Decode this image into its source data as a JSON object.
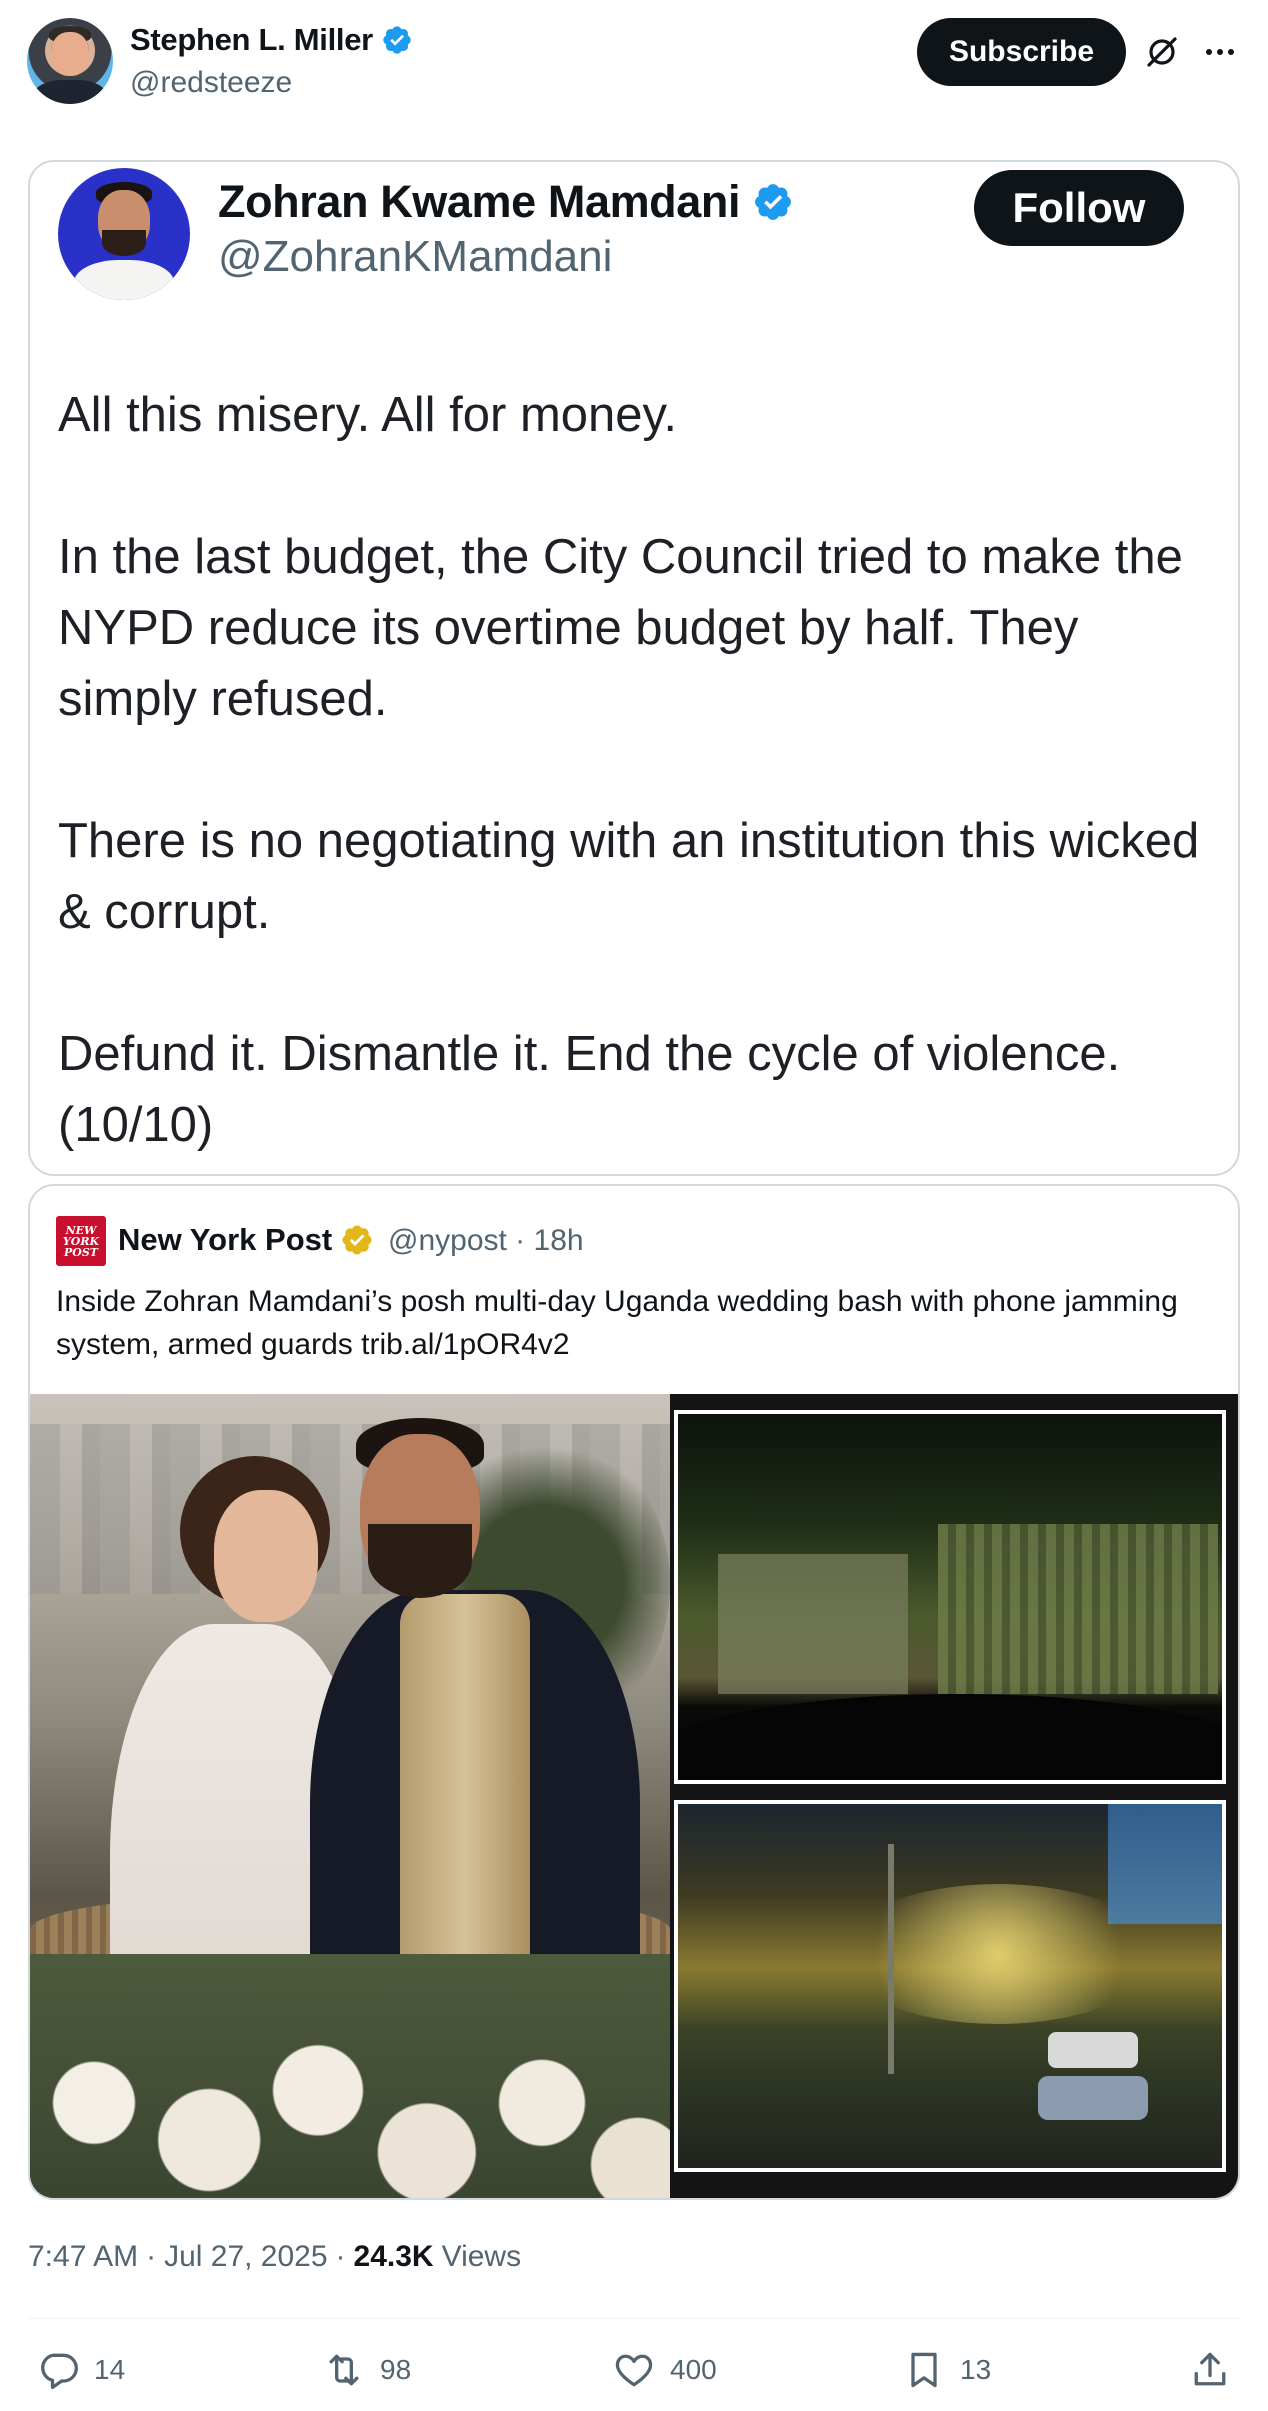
{
  "author": {
    "name": "Stephen L. Miller",
    "handle": "@redsteeze",
    "subscribe_label": "Subscribe",
    "verified_color": "#1d9bf0"
  },
  "embedded_screenshot": {
    "name": "Zohran Kwame Mamdani",
    "handle": "@ZohranKMamdani",
    "follow_label": "Follow",
    "paragraphs": [
      "All this misery. All for money.",
      "In the last budget, the City Council tried to make the NYPD reduce its overtime budget by half. They simply refused.",
      "There is no negotiating with an institution this wicked & corrupt.",
      "Defund it. Dismantle it. End the cycle of violence. (10/10)"
    ]
  },
  "quoted_post": {
    "logo_text": "NEW YORK POST",
    "name": "New York Post",
    "handle": "@nypost",
    "time": "18h",
    "handle_time": "@nypost · 18h",
    "badge_color": "#e2b719",
    "text": "Inside Zohran Mamdani’s posh multi-day Uganda wedding bash with phone jamming system, armed guards trib.al/1pOR4v2"
  },
  "meta": {
    "time": "7:47 AM",
    "date": "Jul 27, 2025",
    "views_count": "24.3K",
    "views_label": "Views"
  },
  "actions": {
    "replies": "14",
    "reposts": "98",
    "likes": "400",
    "bookmarks": "13"
  },
  "icons": [
    "verified-badge-icon",
    "grok-icon",
    "more-icon",
    "gold-verified-icon",
    "reply-icon",
    "repost-icon",
    "like-icon",
    "bookmark-icon",
    "share-icon"
  ]
}
